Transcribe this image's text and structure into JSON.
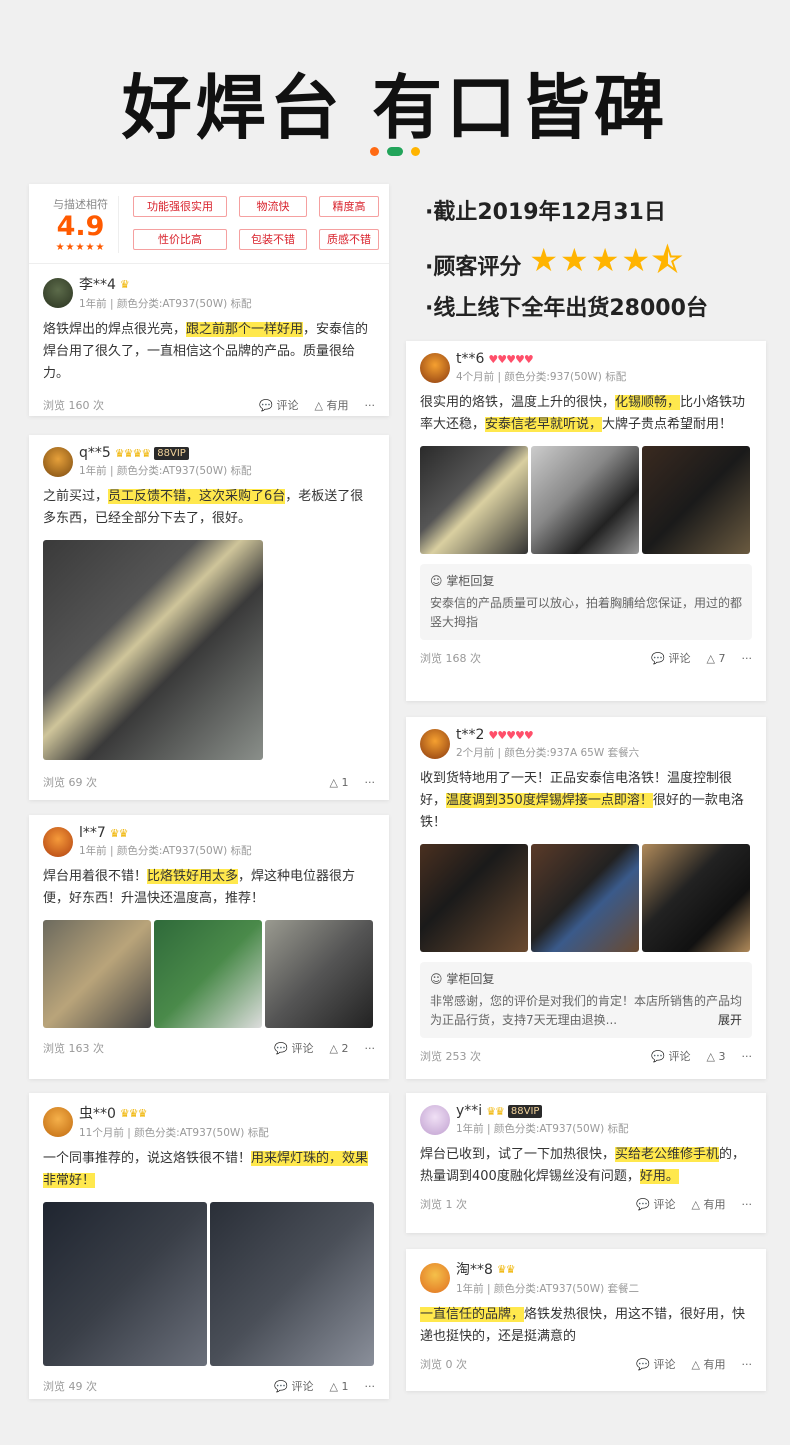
{
  "page": {
    "title": "好焊台 有口皆碑"
  },
  "accent": {
    "dot1": "#ff6a13",
    "dot2": "#22a45a",
    "dot3": "#ffb400",
    "highlight": "#ffe84d",
    "score": "#ff5a00"
  },
  "summary": {
    "line1": "·截止2019年12月31日",
    "line2_label": "·顾客评分",
    "line2_stars": "★★★★⯪",
    "line3": "·线上线下全年出货28000台"
  },
  "rating": {
    "label": "与描述相符",
    "score": "4.9",
    "stars": "★★★★★",
    "tags": [
      "功能强很实用",
      "物流快",
      "精度高",
      "性价比高",
      "包装不错",
      "质感不错"
    ]
  },
  "reviews": {
    "r1": {
      "user": "李**4",
      "crowns": "♛",
      "meta": "1年前 | 颜色分类:AT937(50W) 标配",
      "text_a": "烙铁焊出的焊点很光亮，",
      "text_hl": "跟之前那个一样好用",
      "text_b": "，安泰信的焊台用了很久了，一直相信这个品牌的产品。质量很给力。",
      "views": "浏览 160 次",
      "comment": "评论",
      "useful": "有用",
      "more": "···"
    },
    "r2": {
      "user": "q**5",
      "crowns": "♛♛♛♛",
      "vip": "88VIP",
      "meta": "1年前 | 颜色分类:AT937(50W) 标配",
      "text_a": "之前买过，",
      "text_hl": "员工反馈不错，这次采购了6台",
      "text_b": "，老板送了很多东西，已经全部分下去了，很好。",
      "views": "浏览 69 次",
      "likes": "1",
      "more": "···"
    },
    "r3": {
      "user": "l**7",
      "crowns": "♛♛",
      "meta": "1年前 | 颜色分类:AT937(50W) 标配",
      "text_a": "焊台用着很不错！",
      "text_hl": "比烙铁好用太多",
      "text_b": "，焊这种电位器很方便，好东西！升温快还温度高，推荐！",
      "views": "浏览 163 次",
      "comment": "评论",
      "likes": "2",
      "more": "···"
    },
    "r4": {
      "user": "虫**0",
      "crowns": "♛♛♛",
      "meta": "11个月前 | 颜色分类:AT937(50W) 标配",
      "text_a": "一个同事推荐的，说这烙铁很不错！",
      "text_hl": "用来焊灯珠的，效果非常好！",
      "text_b": "",
      "views": "浏览 49 次",
      "comment": "评论",
      "likes": "1",
      "more": "···"
    },
    "r5": {
      "user": "t**6",
      "hearts": "♥♥♥♥♥",
      "meta": "4个月前 | 颜色分类:937(50W) 标配",
      "text_a": "很实用的烙铁，温度上升的很快，",
      "text_hl": "化锡顺畅，",
      "text_b": "比小烙铁功率大还稳，",
      "text_hl2": "安泰信老早就听说，",
      "text_c": "大牌子贵点希望耐用！",
      "reply_title": "掌柜回复",
      "reply_body": "安泰信的产品质量可以放心，拍着胸脯给您保证，用过的都竖大拇指",
      "views": "浏览 168 次",
      "comment": "评论",
      "likes": "7",
      "more": "···"
    },
    "r6": {
      "user": "t**2",
      "hearts": "♥♥♥♥♥",
      "meta": "2个月前 | 颜色分类:937A 65W 套餐六",
      "text_a": "收到货特地用了一天！正品安泰信电洛铁！温度控制很好，",
      "text_hl": "温度调到350度焊锡焊接一点即溶！",
      "text_b": "很好的一款电洛铁！",
      "reply_title": "掌柜回复",
      "reply_body": "非常感谢，您的评价是对我们的肯定！本店所销售的产品均为正品行货，支持7天无理由退换...",
      "reply_expand": "展开",
      "views": "浏览 253 次",
      "comment": "评论",
      "likes": "3",
      "more": "···"
    },
    "r7": {
      "user": "y**i",
      "crowns": "♛♛",
      "vip": "88VIP",
      "meta": "1年前 | 颜色分类:AT937(50W) 标配",
      "text_a": "焊台已收到，试了一下加热很快，",
      "text_hl": "买给老公维修手机",
      "text_b": "的，热量调到400度融化焊锡丝没有问题，",
      "text_hl2": "好用。",
      "views": "浏览 1 次",
      "comment": "评论",
      "useful": "有用",
      "more": "···"
    },
    "r8": {
      "user": "淘**8",
      "crowns": "♛♛",
      "meta": "1年前 | 颜色分类:AT937(50W) 套餐二",
      "text_hl": "一直信任的品牌，",
      "text_b": "烙铁发热很快，用这不错，很好用，快递也挺快的，还是挺满意的",
      "views": "浏览 0 次",
      "comment": "评论",
      "useful": "有用",
      "more": "···"
    }
  }
}
